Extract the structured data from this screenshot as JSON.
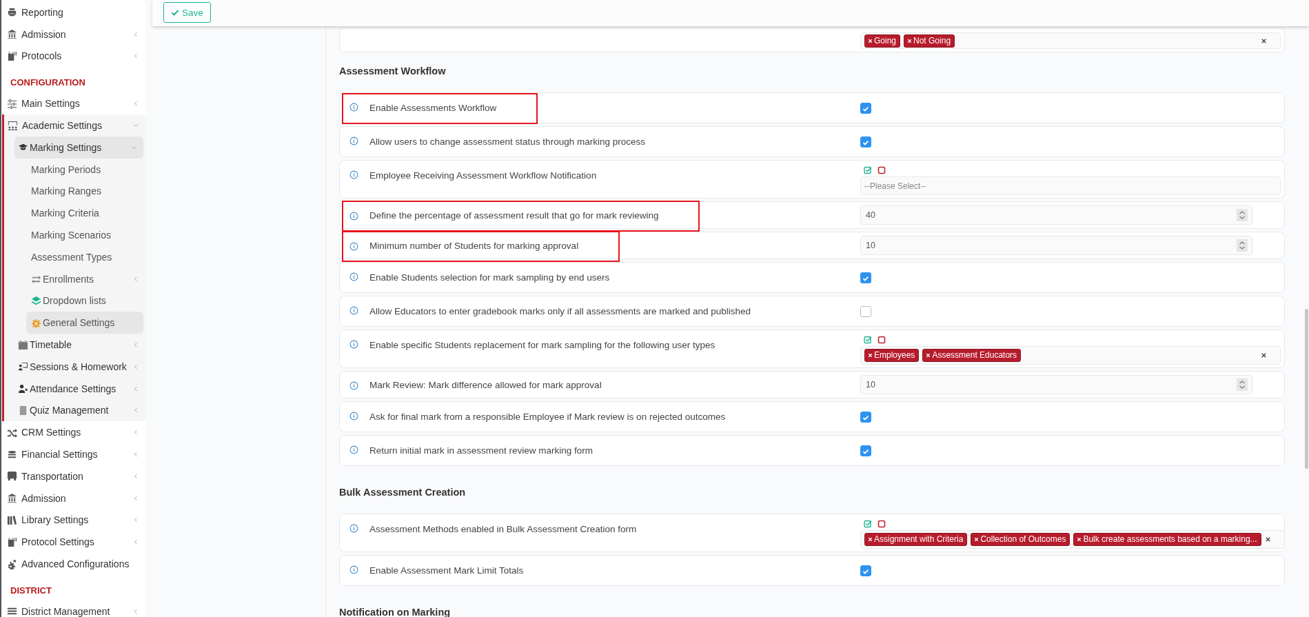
{
  "toolbar": {
    "save_label": "Save"
  },
  "sidebar": {
    "groups": [
      {
        "items": [
          {
            "label": "Reporting",
            "selected": false
          },
          {
            "label": "Admission",
            "selected": false,
            "expanded": false
          },
          {
            "label": "Protocols",
            "selected": false,
            "expanded": false
          }
        ]
      },
      {
        "heading": "CONFIGURATION",
        "items": [
          {
            "label": "Main Settings",
            "selected": false,
            "expanded": false
          },
          {
            "label": "Academic Settings",
            "selected": false,
            "expanded": true,
            "children": [
              {
                "label": "Marking Settings",
                "selected": true,
                "expanded": true,
                "children": [
                  {
                    "label": "Marking Periods",
                    "selected": false
                  },
                  {
                    "label": "Marking Ranges",
                    "selected": false
                  },
                  {
                    "label": "Marking Criteria",
                    "selected": false
                  },
                  {
                    "label": "Marking Scenarios",
                    "selected": false
                  },
                  {
                    "label": "Assessment Types",
                    "selected": false
                  },
                  {
                    "label": "Enrollments",
                    "selected": false,
                    "expanded": false
                  },
                  {
                    "label": "Dropdown lists",
                    "selected": false
                  },
                  {
                    "label": "General Settings",
                    "selected": true
                  }
                ]
              },
              {
                "label": "Timetable",
                "selected": false,
                "expanded": false
              },
              {
                "label": "Sessions & Homework",
                "selected": false,
                "expanded": false
              },
              {
                "label": "Attendance Settings",
                "selected": false,
                "expanded": false
              },
              {
                "label": "Quiz Management",
                "selected": false,
                "expanded": false
              }
            ]
          },
          {
            "label": "CRM Settings",
            "selected": false,
            "expanded": false
          },
          {
            "label": "Financial Settings",
            "selected": false,
            "expanded": false
          },
          {
            "label": "Transportation",
            "selected": false,
            "expanded": false
          },
          {
            "label": "Admission",
            "selected": false,
            "expanded": false
          },
          {
            "label": "Library Settings",
            "selected": false,
            "expanded": false
          },
          {
            "label": "Protocol Settings",
            "selected": false,
            "expanded": false
          },
          {
            "label": "Advanced Configurations",
            "selected": false
          }
        ]
      },
      {
        "heading": "DISTRICT",
        "items": [
          {
            "label": "District Management",
            "selected": false,
            "expanded": false
          }
        ]
      }
    ]
  },
  "sections": [
    {
      "rows": [
        {
          "kind": "multiselect",
          "highlighted": false,
          "tags": [
            "Going",
            "Not Going"
          ]
        }
      ]
    },
    {
      "title": "Assessment Workflow",
      "rows": [
        {
          "kind": "checkbox",
          "label": "Enable Assessments Workflow",
          "checked": true,
          "highlighted": true
        },
        {
          "kind": "checkbox",
          "label": "Allow users to change assessment status through marking process",
          "checked": true,
          "highlighted": false
        },
        {
          "kind": "multiselect",
          "label": "Employee Receiving Assessment Workflow Notification",
          "placeholder": "--Please Select--",
          "highlighted": false
        },
        {
          "kind": "number",
          "label": "Define the percentage of assessment result that go for mark reviewing",
          "value": "40",
          "highlighted": true
        },
        {
          "kind": "number",
          "label": "Minimum number of Students for marking approval",
          "value": "10",
          "highlighted": true
        },
        {
          "kind": "checkbox",
          "label": "Enable Students selection for mark sampling by end users",
          "checked": true,
          "highlighted": false
        },
        {
          "kind": "checkbox",
          "label": "Allow Educators to enter gradebook marks only if all assessments are marked and published",
          "checked": false,
          "highlighted": false
        },
        {
          "kind": "multiselect",
          "label": "Enable specific Students replacement for mark sampling for the following user types",
          "tags": [
            "Employees",
            "Assessment Educators"
          ],
          "highlighted": false
        },
        {
          "kind": "number",
          "label": "Mark Review: Mark difference allowed for mark approval",
          "value": "10",
          "highlighted": false
        },
        {
          "kind": "checkbox",
          "label": "Ask for final mark from a responsible Employee if Mark review is on rejected outcomes",
          "checked": true,
          "highlighted": false
        },
        {
          "kind": "checkbox",
          "label": "Return initial mark in assessment review marking form",
          "checked": true,
          "highlighted": false
        }
      ]
    },
    {
      "title": "Bulk Assessment Creation",
      "rows": [
        {
          "kind": "multiselect",
          "label": "Assessment Methods enabled in Bulk Assessment Creation form",
          "tags": [
            "Assignment with Criteria",
            "Collection of Outcomes",
            "Bulk create assessments based on a marking..."
          ],
          "highlighted": false
        },
        {
          "kind": "checkbox",
          "label": "Enable Assessment Mark Limit Totals",
          "checked": true,
          "highlighted": false
        }
      ]
    },
    {
      "title": "Notification on Marking"
    }
  ]
}
